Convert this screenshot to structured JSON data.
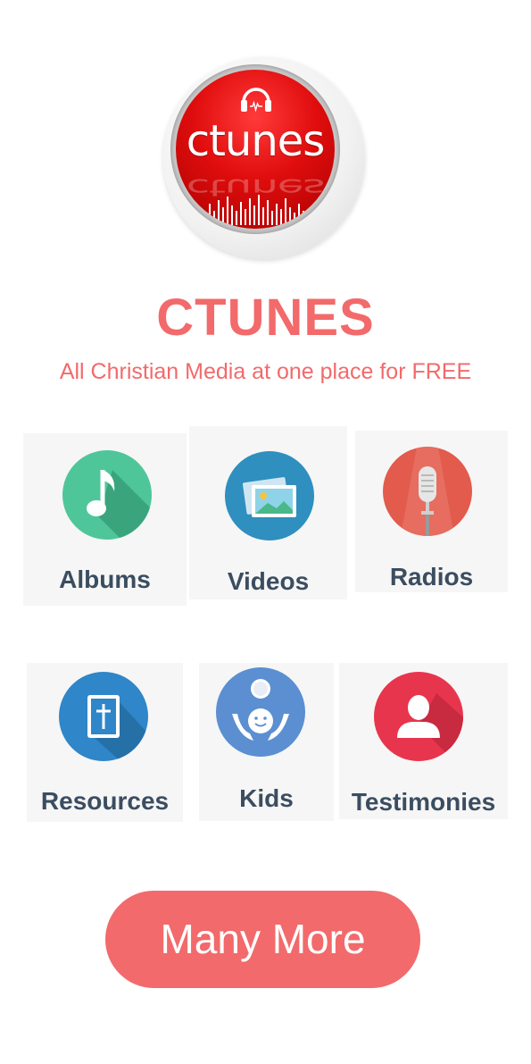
{
  "logo": {
    "text": "ctunes",
    "icon": "headphones-icon"
  },
  "brand": {
    "title": "CTUNES",
    "subtitle": "All Christian Media at one place for FREE"
  },
  "colors": {
    "accent": "#f26a6b",
    "label": "#3b4d60",
    "tile_bg": "#f6f6f6"
  },
  "tiles": [
    {
      "label": "Albums",
      "icon": "music-note-icon",
      "color": "#4fc69a"
    },
    {
      "label": "Videos",
      "icon": "image-gallery-icon",
      "color": "#2f8fbf"
    },
    {
      "label": "Radios",
      "icon": "microphone-icon",
      "color": "#e25b4d"
    },
    {
      "label": "Resources",
      "icon": "bible-icon",
      "color": "#2f86c8"
    },
    {
      "label": "Kids",
      "icon": "child-icon",
      "color": "#5b8fd2"
    },
    {
      "label": "Testimonies",
      "icon": "person-icon",
      "color": "#e8354e"
    }
  ],
  "more_button": {
    "label": "Many More"
  }
}
